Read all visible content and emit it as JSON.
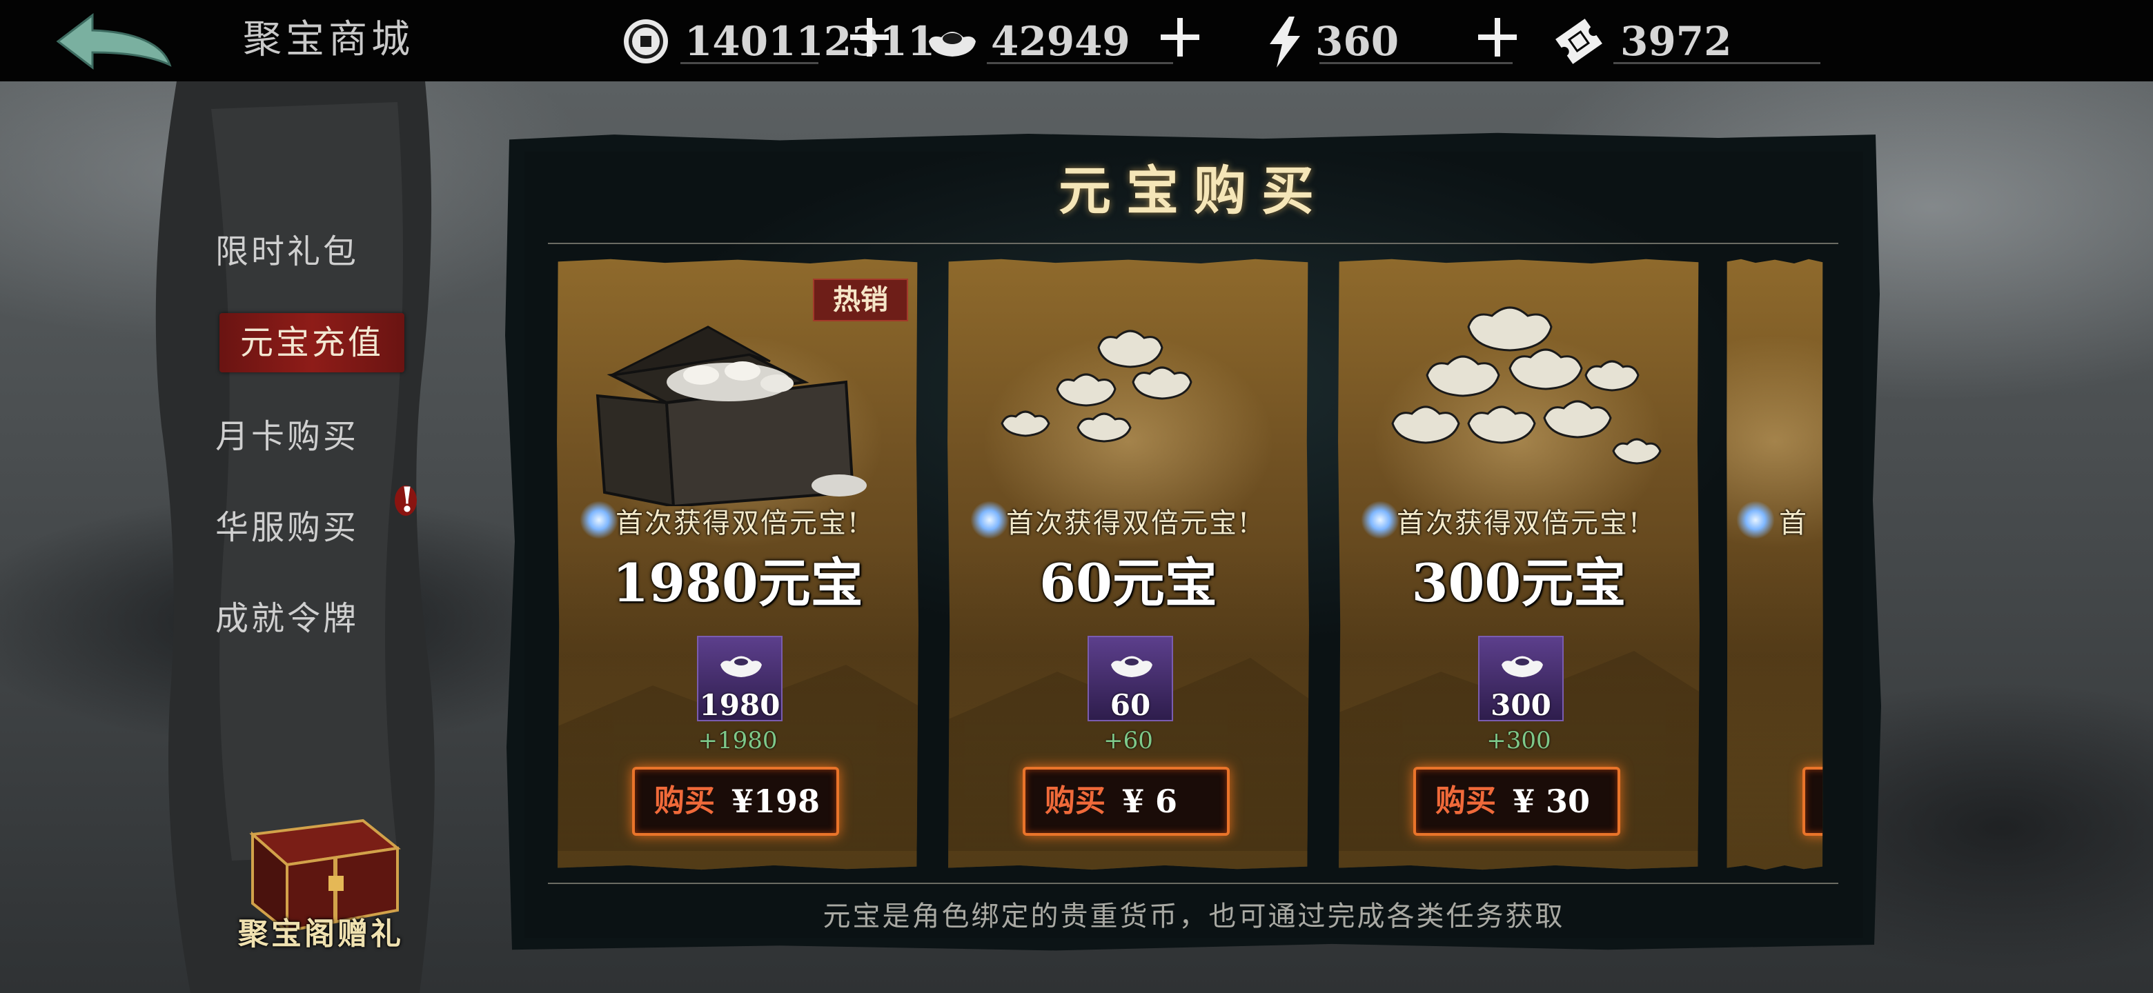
{
  "header": {
    "title": "聚宝商城",
    "resources": [
      {
        "icon": "copper-coin-icon",
        "value": "140112311"
      },
      {
        "icon": "gold-ingot-icon",
        "value": "42949"
      },
      {
        "icon": "lightning-icon",
        "value": "360"
      },
      {
        "icon": "ticket-icon",
        "value": "3972"
      }
    ]
  },
  "sidebar": {
    "items": [
      {
        "label": "限时礼包",
        "active": false
      },
      {
        "label": "元宝充值",
        "active": true
      },
      {
        "label": "月卡购买",
        "active": false
      },
      {
        "label": "华服购买",
        "active": false,
        "alert": "!"
      },
      {
        "label": "成就令牌",
        "active": false
      }
    ],
    "gift": {
      "label": "聚宝阁赠礼"
    }
  },
  "panel": {
    "title": "元宝购买",
    "footer": "元宝是角色绑定的贵重货币，也可通过完成各类任务获取"
  },
  "cards": [
    {
      "badge": "热销",
      "first_bonus": "首次获得双倍元宝!",
      "amount": "1980元宝",
      "item_qty": "1980",
      "bonus_qty": "+1980",
      "buy_label": "购买",
      "price": "¥198"
    },
    {
      "first_bonus": "首次获得双倍元宝!",
      "amount": "60元宝",
      "item_qty": "60",
      "bonus_qty": "+60",
      "buy_label": "购买",
      "price": "¥ 6"
    },
    {
      "first_bonus": "首次获得双倍元宝!",
      "amount": "300元宝",
      "item_qty": "300",
      "bonus_qty": "+300",
      "buy_label": "购买",
      "price": "¥ 30"
    },
    {
      "first_bonus_partial": "首"
    }
  ],
  "colors": {
    "accent_red": "#8e1c18",
    "button_orange": "#e9742a",
    "bonus_green": "#7ec98a"
  }
}
